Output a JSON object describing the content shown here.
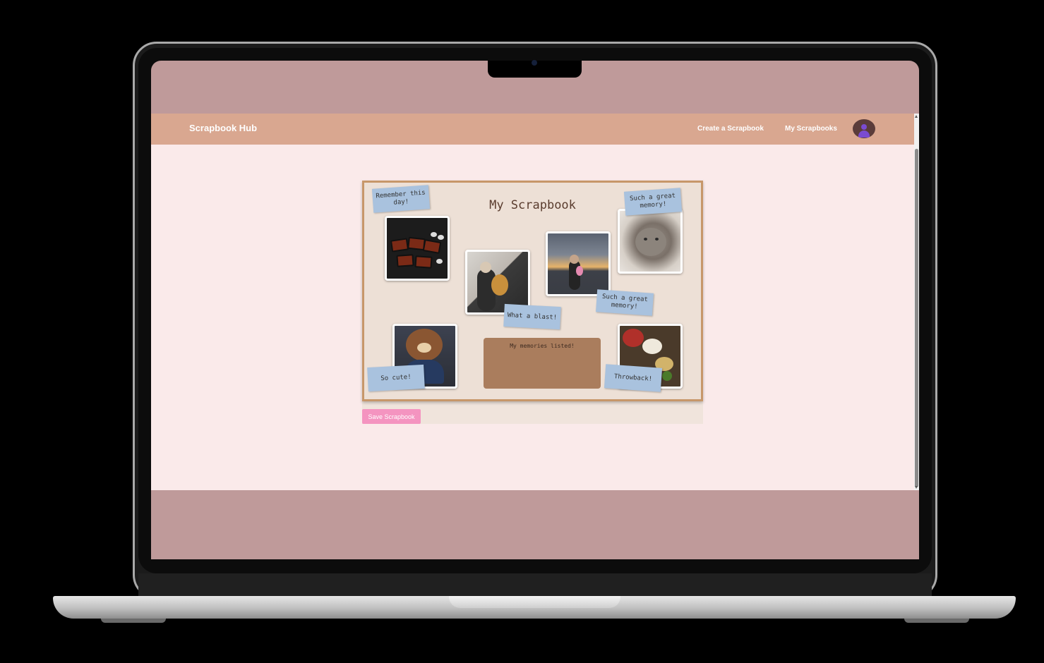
{
  "app": {
    "brand": "Scrapbook Hub",
    "nav": [
      "Create a Scrapbook",
      "My Scrapbooks"
    ]
  },
  "scrapbook": {
    "title": "My Scrapbook",
    "notes": {
      "remember": "Remember this day!",
      "great_memory_top": "Such a great memory!",
      "blast": "What a blast!",
      "great_memory_mid": "Such a great memory!",
      "cute": "So cute!",
      "throwback": "Throwback!"
    },
    "memories_box": "My memories listed!",
    "save_label": "Save Scrapbook"
  },
  "colors": {
    "navbar": "#d9a790",
    "page_bg": "#faeaea",
    "board_border": "#c7976a",
    "note": "#a9c2de",
    "memories_box": "#aa7d5d",
    "save_button": "#f494c0"
  }
}
